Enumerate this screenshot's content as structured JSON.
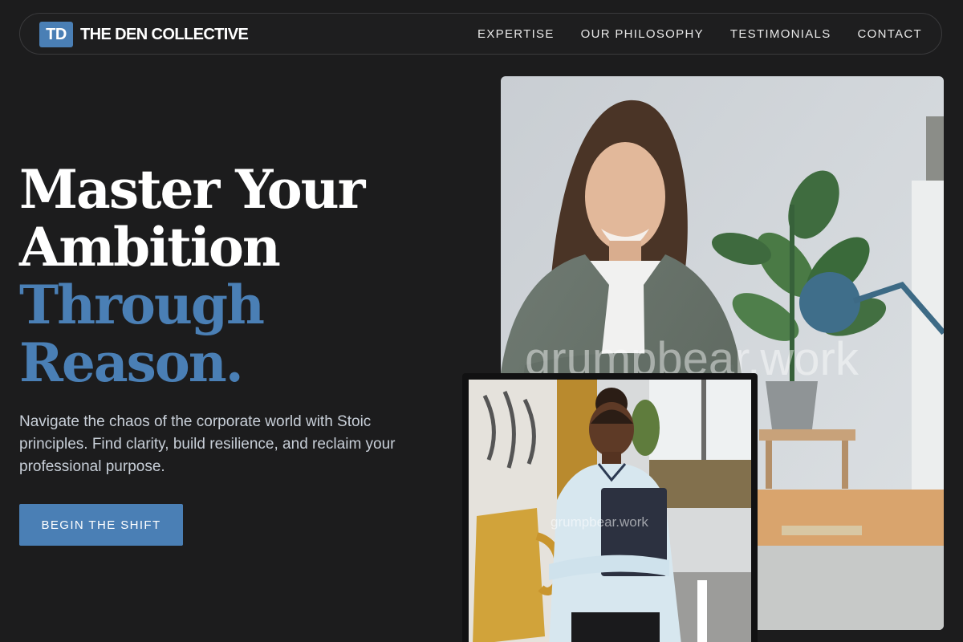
{
  "brand": {
    "mark": "TD",
    "name": "THE DEN COLLECTIVE"
  },
  "nav": {
    "items": [
      "EXPERTISE",
      "OUR PHILOSOPHY",
      "TESTIMONIALS",
      "CONTACT"
    ]
  },
  "hero": {
    "title_lines": [
      "Master Your",
      "Ambition"
    ],
    "title_accent_lines": [
      "Through",
      "Reason."
    ],
    "subtitle": "Navigate the chaos of the corporate world with Stoic principles. Find clarity, build resilience, and reclaim your professional purpose.",
    "cta_label": "BEGIN THE SHIFT"
  },
  "images": {
    "main": {
      "watermark": "grumpbear.work"
    },
    "secondary": {
      "watermark": "grumpbear.work"
    }
  },
  "colors": {
    "background": "#1c1c1d",
    "accent": "#4a7fb5",
    "text": "#ffffff",
    "subtext": "#c8cfd8"
  }
}
